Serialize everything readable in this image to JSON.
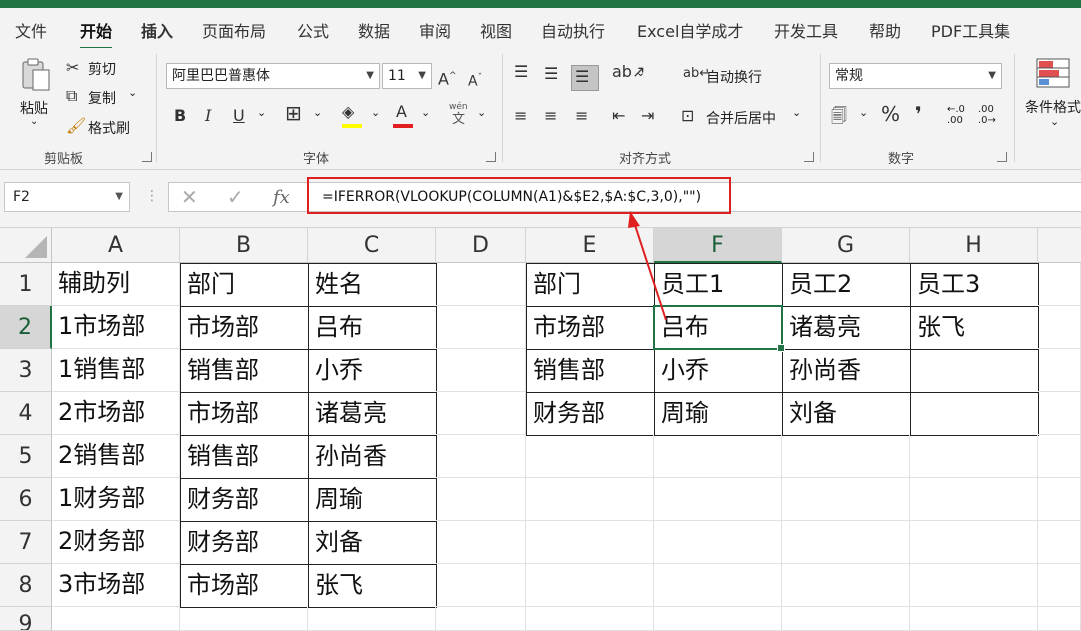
{
  "ribbon_tabs": [
    "文件",
    "开始",
    "插入",
    "页面布局",
    "公式",
    "数据",
    "审阅",
    "视图",
    "自动执行",
    "Excel自学成才",
    "开发工具",
    "帮助",
    "PDF工具集"
  ],
  "clipboard": {
    "paste": "粘贴",
    "cut": "剪切",
    "copy": "复制",
    "format_painter": "格式刷",
    "group": "剪贴板"
  },
  "font": {
    "name": "阿里巴巴普惠体",
    "size": "11",
    "group": "字体",
    "wen_label": "wén"
  },
  "alignment": {
    "wrap": "自动换行",
    "merge": "合并后居中",
    "group": "对齐方式"
  },
  "number": {
    "format": "常规",
    "group": "数字",
    "dec_inc": ".00",
    "dec_dec": ".0"
  },
  "styles": {
    "conditional": "条件格式"
  },
  "formula_bar": {
    "name_box": "F2",
    "formula": "=IFERROR(VLOOKUP(COLUMN(A1)&$E2,$A:$C,3,0),\"\")"
  },
  "columns": [
    "A",
    "B",
    "C",
    "D",
    "E",
    "F",
    "G",
    "H"
  ],
  "rows": [
    "1",
    "2",
    "3",
    "4",
    "5",
    "6",
    "7",
    "8",
    "9"
  ],
  "cells": {
    "A": [
      "辅助列",
      "1市场部",
      "1销售部",
      "2市场部",
      "2销售部",
      "1财务部",
      "2财务部",
      "3市场部"
    ],
    "B": [
      "部门",
      "市场部",
      "销售部",
      "市场部",
      "销售部",
      "财务部",
      "财务部",
      "市场部"
    ],
    "C": [
      "姓名",
      "吕布",
      "小乔",
      "诸葛亮",
      "孙尚香",
      "周瑜",
      "刘备",
      "张飞"
    ],
    "E": [
      "部门",
      "市场部",
      "销售部",
      "财务部"
    ],
    "F": [
      "员工1",
      "吕布",
      "小乔",
      "周瑜"
    ],
    "G": [
      "员工2",
      "诸葛亮",
      "孙尚香",
      "刘备"
    ],
    "H": [
      "员工3",
      "张飞",
      "",
      ""
    ]
  },
  "colors": {
    "accent": "#217346",
    "highlight": "#e02020",
    "fill_color": "#ffff00",
    "font_color": "#e02020"
  }
}
